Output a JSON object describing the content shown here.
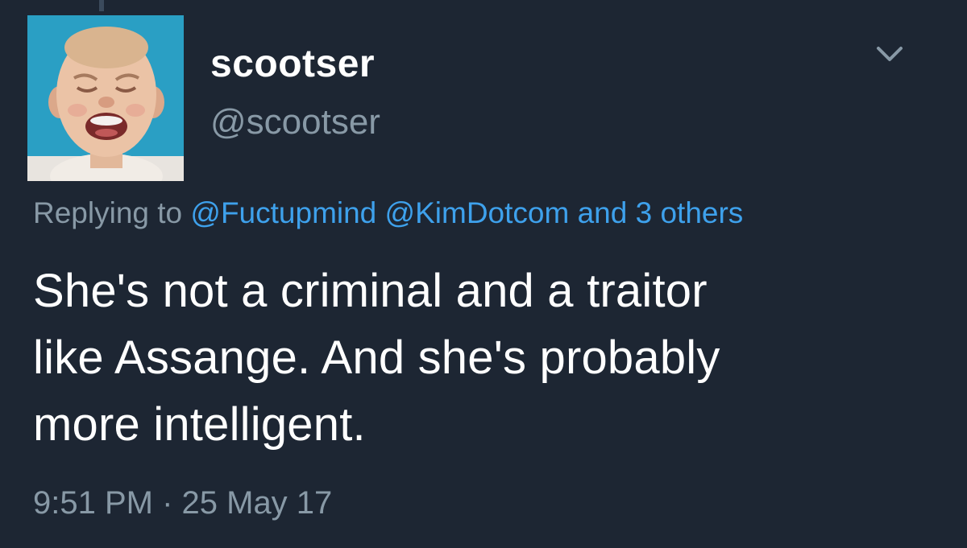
{
  "tweet": {
    "avatar_alt": "crying baby profile picture",
    "display_name": "scootser",
    "handle": "@scootser",
    "menu_icon": "chevron-down-icon",
    "reply": {
      "prefix": "Replying to",
      "mentions": [
        "@Fuctupmind",
        "@KimDotcom"
      ],
      "others": "and 3 others"
    },
    "text_lines": [
      "She's not a criminal and a traitor",
      "like Assange. And she's probably",
      "more intelligent."
    ],
    "timestamp": "9:51 PM · 25 May 17"
  },
  "colors": {
    "background": "#1d2633",
    "primary_text": "#ffffff",
    "secondary_text": "#8899a6",
    "link": "#3ea1ec"
  }
}
